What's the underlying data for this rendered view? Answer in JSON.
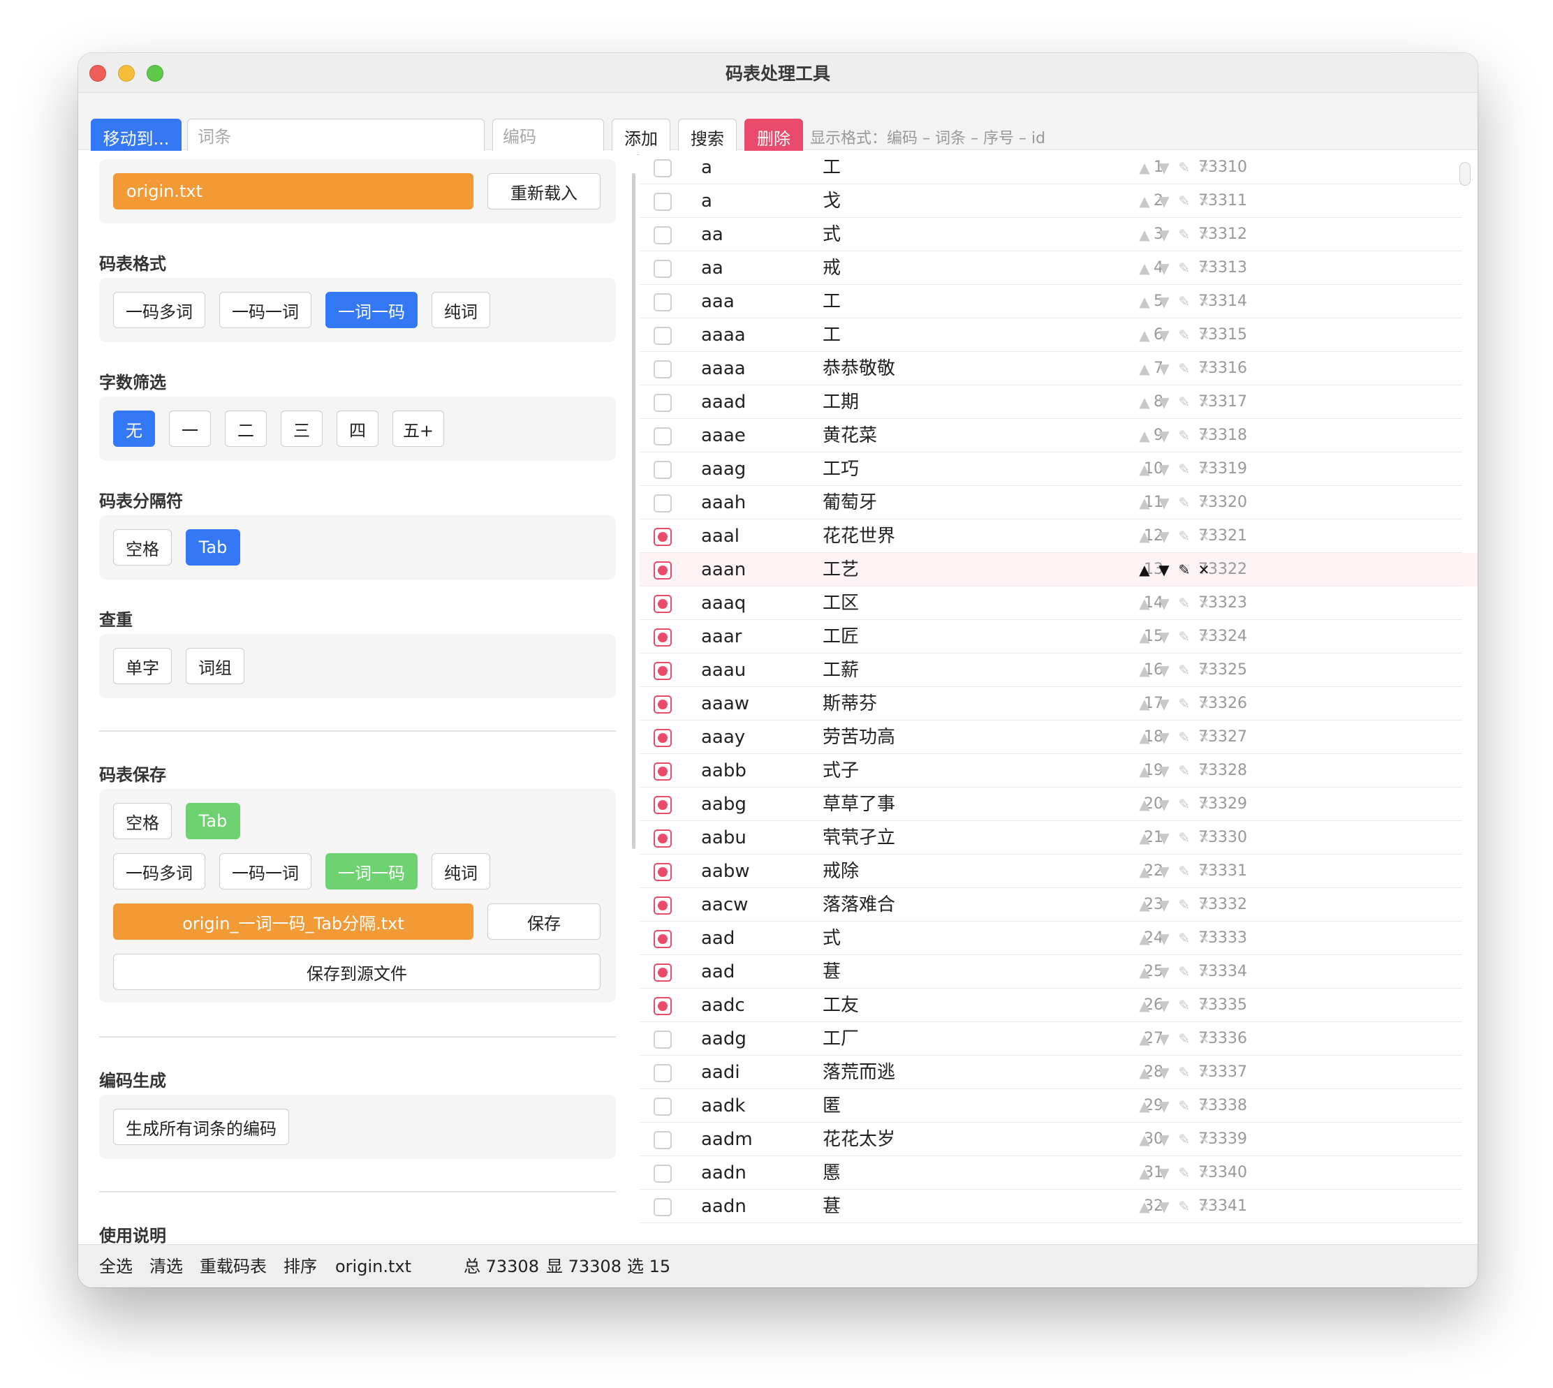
{
  "window": {
    "title": "码表处理工具"
  },
  "toolbar": {
    "move_label": "移动到...",
    "word_placeholder": "词条",
    "code_placeholder": "编码",
    "add_label": "添加",
    "search_label": "搜索",
    "delete_label": "删除",
    "display_format": "显示格式：编码 – 词条 – 序号 – id"
  },
  "sidebar": {
    "file": {
      "name": "origin.txt",
      "reload_label": "重新载入"
    },
    "format": {
      "title": "码表格式",
      "options": [
        "一码多词",
        "一码一词",
        "一词一码",
        "纯词"
      ],
      "selected": "一词一码"
    },
    "char_filter": {
      "title": "字数筛选",
      "options": [
        "无",
        "一",
        "二",
        "三",
        "四",
        "五+"
      ],
      "selected": "无"
    },
    "separator": {
      "title": "码表分隔符",
      "options": [
        "空格",
        "Tab"
      ],
      "selected": "Tab"
    },
    "dedup": {
      "title": "查重",
      "options": [
        "单字",
        "词组"
      ]
    },
    "save": {
      "title": "码表保存",
      "separator_options": [
        "空格",
        "Tab"
      ],
      "separator_selected": "Tab",
      "format_options": [
        "一码多词",
        "一码一词",
        "一词一码",
        "纯词"
      ],
      "format_selected": "一词一码",
      "filename": "origin_一词一码_Tab分隔.txt",
      "save_label": "保存",
      "save_source_label": "保存到源文件"
    },
    "generate": {
      "title": "编码生成",
      "button_label": "生成所有词条的编码"
    },
    "help": {
      "title": "使用说明"
    }
  },
  "list": {
    "rows": [
      {
        "code": "a",
        "word": "工",
        "seq": "1",
        "id": "73310",
        "checked": false
      },
      {
        "code": "a",
        "word": "戈",
        "seq": "2",
        "id": "73311",
        "checked": false
      },
      {
        "code": "aa",
        "word": "式",
        "seq": "3",
        "id": "73312",
        "checked": false
      },
      {
        "code": "aa",
        "word": "戒",
        "seq": "4",
        "id": "73313",
        "checked": false
      },
      {
        "code": "aaa",
        "word": "工",
        "seq": "5",
        "id": "73314",
        "checked": false
      },
      {
        "code": "aaaa",
        "word": "工",
        "seq": "6",
        "id": "73315",
        "checked": false
      },
      {
        "code": "aaaa",
        "word": "恭恭敬敬",
        "seq": "7",
        "id": "73316",
        "checked": false
      },
      {
        "code": "aaad",
        "word": "工期",
        "seq": "8",
        "id": "73317",
        "checked": false
      },
      {
        "code": "aaae",
        "word": "黄花菜",
        "seq": "9",
        "id": "73318",
        "checked": false
      },
      {
        "code": "aaag",
        "word": "工巧",
        "seq": "10",
        "id": "73319",
        "checked": false
      },
      {
        "code": "aaah",
        "word": "葡萄牙",
        "seq": "11",
        "id": "73320",
        "checked": false
      },
      {
        "code": "aaal",
        "word": "花花世界",
        "seq": "12",
        "id": "73321",
        "checked": true
      },
      {
        "code": "aaan",
        "word": "工艺",
        "seq": "13",
        "id": "73322",
        "checked": true,
        "highlighted": true
      },
      {
        "code": "aaaq",
        "word": "工区",
        "seq": "14",
        "id": "73323",
        "checked": true
      },
      {
        "code": "aaar",
        "word": "工匠",
        "seq": "15",
        "id": "73324",
        "checked": true
      },
      {
        "code": "aaau",
        "word": "工薪",
        "seq": "16",
        "id": "73325",
        "checked": true
      },
      {
        "code": "aaaw",
        "word": "斯蒂芬",
        "seq": "17",
        "id": "73326",
        "checked": true
      },
      {
        "code": "aaay",
        "word": "劳苦功高",
        "seq": "18",
        "id": "73327",
        "checked": true
      },
      {
        "code": "aabb",
        "word": "式子",
        "seq": "19",
        "id": "73328",
        "checked": true
      },
      {
        "code": "aabg",
        "word": "草草了事",
        "seq": "20",
        "id": "73329",
        "checked": true
      },
      {
        "code": "aabu",
        "word": "茕茕孑立",
        "seq": "21",
        "id": "73330",
        "checked": true
      },
      {
        "code": "aabw",
        "word": "戒除",
        "seq": "22",
        "id": "73331",
        "checked": true
      },
      {
        "code": "aacw",
        "word": "落落难合",
        "seq": "23",
        "id": "73332",
        "checked": true
      },
      {
        "code": "aad",
        "word": "式",
        "seq": "24",
        "id": "73333",
        "checked": true
      },
      {
        "code": "aad",
        "word": "葚",
        "seq": "25",
        "id": "73334",
        "checked": true
      },
      {
        "code": "aadc",
        "word": "工友",
        "seq": "26",
        "id": "73335",
        "checked": true
      },
      {
        "code": "aadg",
        "word": "工厂",
        "seq": "27",
        "id": "73336",
        "checked": false
      },
      {
        "code": "aadi",
        "word": "落荒而逃",
        "seq": "28",
        "id": "73337",
        "checked": false
      },
      {
        "code": "aadk",
        "word": "匿",
        "seq": "29",
        "id": "73338",
        "checked": false
      },
      {
        "code": "aadm",
        "word": "花花太岁",
        "seq": "30",
        "id": "73339",
        "checked": false
      },
      {
        "code": "aadn",
        "word": "慝",
        "seq": "31",
        "id": "73340",
        "checked": false
      },
      {
        "code": "aadn",
        "word": "葚",
        "seq": "32",
        "id": "73341",
        "checked": false
      }
    ],
    "actions": [
      "move-up-icon",
      "move-down-icon",
      "edit-icon",
      "delete-icon"
    ]
  },
  "statusbar": {
    "select_all": "全选",
    "clear": "清选",
    "reload": "重载码表",
    "sort": "排序",
    "filename": "origin.txt",
    "total": "总 73308",
    "shown": "显 73308",
    "selected": "选 15"
  }
}
